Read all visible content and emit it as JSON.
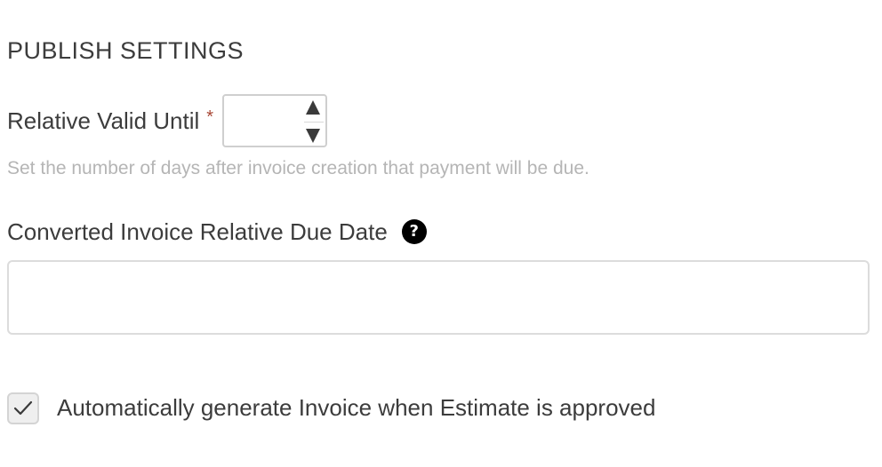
{
  "section": {
    "title": "PUBLISH SETTINGS"
  },
  "relative_valid_until": {
    "label": "Relative Valid Until",
    "required_marker": "*",
    "value": "",
    "help_text": "Set the number of days after invoice creation that payment will be due."
  },
  "converted_due_date": {
    "label": "Converted Invoice Relative Due Date",
    "help_icon": "question-circle-icon",
    "help_glyph": "?",
    "value": ""
  },
  "auto_generate": {
    "label": "Automatically generate Invoice when Estimate is approved",
    "checked": true
  },
  "colors": {
    "required": "#a84634",
    "help_text": "#b5b5b5",
    "border": "#dcdcdc"
  }
}
